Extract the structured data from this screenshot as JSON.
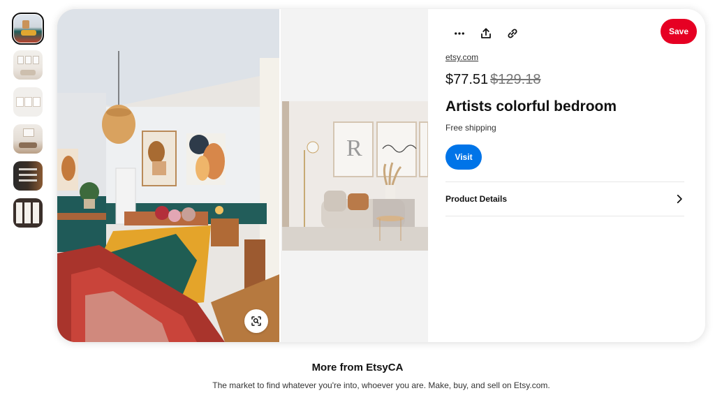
{
  "thumbnails": [
    {
      "name": "thumb-bedroom",
      "active": true
    },
    {
      "name": "thumb-prints-wall",
      "active": false
    },
    {
      "name": "thumb-prints-frames",
      "active": false
    },
    {
      "name": "thumb-living-room",
      "active": false
    },
    {
      "name": "thumb-dark-sign",
      "active": false
    },
    {
      "name": "thumb-mockups",
      "active": false
    }
  ],
  "pin": {
    "actions": {
      "more_icon": "more-horizontal-icon",
      "share_icon": "share-upload-icon",
      "link_icon": "link-icon"
    },
    "save_label": "Save",
    "source": "etsy.com",
    "price": "$77.51",
    "original_price": "$129.18",
    "title": "Artists colorful bedroom",
    "shipping": "Free shipping",
    "visit_label": "Visit",
    "product_details_label": "Product Details"
  },
  "footer": {
    "more_from_prefix": "More from",
    "more_from_name": "EtsyCA",
    "description": "The market to find whatever you're into, whoever you are. Make, buy, and sell on Etsy.com."
  },
  "colors": {
    "save_red": "#e60023",
    "visit_blue": "#0074e8"
  }
}
